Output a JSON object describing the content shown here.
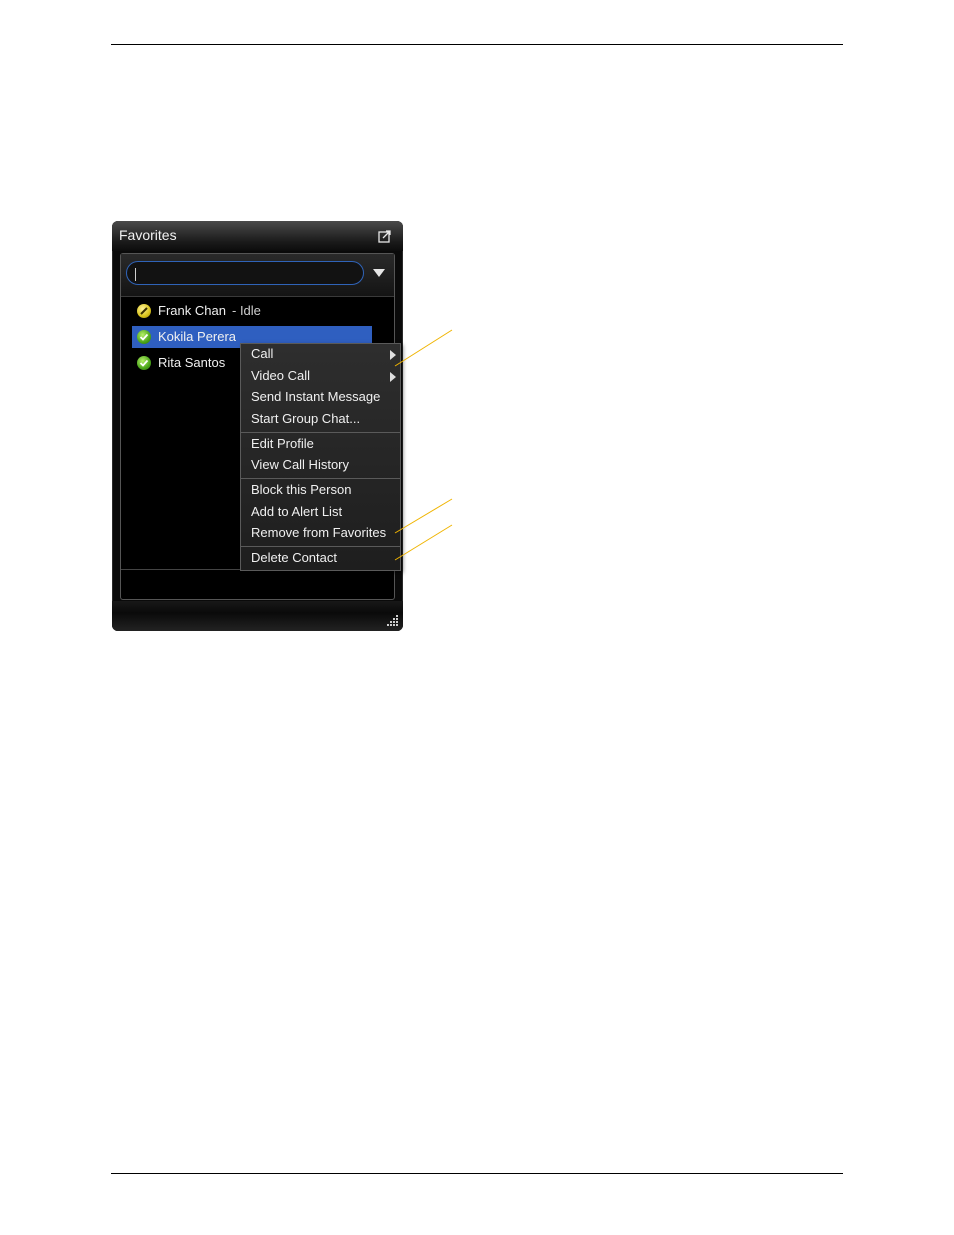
{
  "window": {
    "title": "Favorites",
    "search": {
      "value": "",
      "placeholder": ""
    }
  },
  "contacts": [
    {
      "name": "Frank Chan",
      "status_text": "- Idle",
      "status": "idle",
      "selected": false
    },
    {
      "name": "Kokila Perera",
      "status_text": "",
      "status": "available",
      "selected": true
    },
    {
      "name": "Rita Santos",
      "status_text": "",
      "status": "available",
      "selected": false
    }
  ],
  "context_menu": {
    "items": [
      {
        "label": "Call",
        "submenu": true
      },
      {
        "label": "Video Call",
        "submenu": true
      },
      {
        "label": "Send Instant Message",
        "submenu": false
      },
      {
        "label": "Start Group Chat...",
        "submenu": false
      },
      {
        "label": "Edit Profile",
        "submenu": false
      },
      {
        "label": "View Call History",
        "submenu": false
      },
      {
        "label": "Block this Person",
        "submenu": false
      },
      {
        "label": "Add to Alert List",
        "submenu": false
      },
      {
        "label": "Remove from Favorites",
        "submenu": false
      },
      {
        "label": "Delete Contact",
        "submenu": false
      }
    ]
  },
  "colors": {
    "selection": "#2f5fc0",
    "callout_line": "#f0b400",
    "available": "#4aa51a",
    "idle": "#d8c21a"
  },
  "icons": {
    "popout": "popout-icon",
    "dropdown": "chevron-down-icon",
    "status_available": "check-icon",
    "status_idle": "idle-icon",
    "resize": "resize-grip-icon"
  }
}
